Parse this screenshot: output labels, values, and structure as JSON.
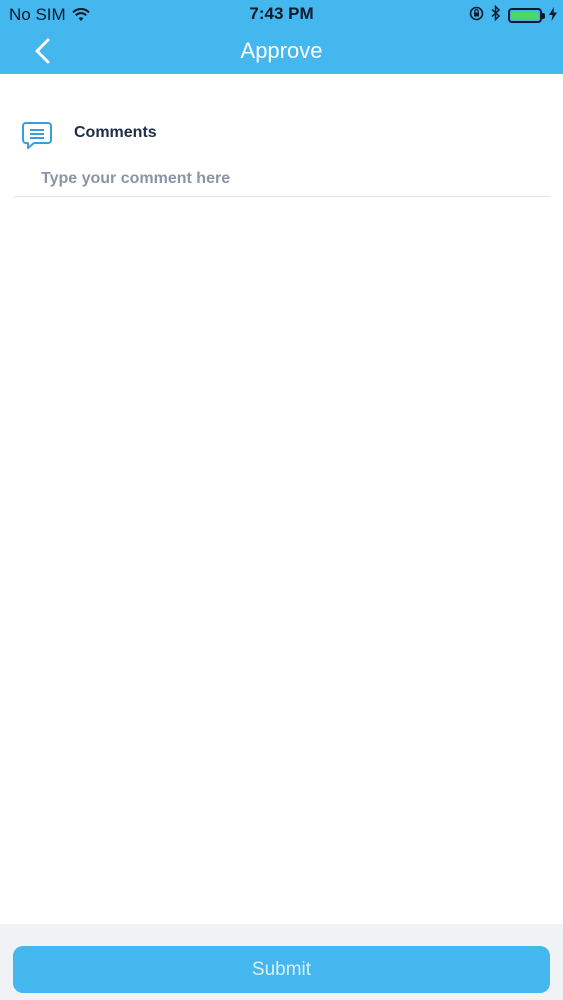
{
  "status_bar": {
    "carrier": "No SIM",
    "time": "7:43 PM"
  },
  "nav": {
    "title": "Approve"
  },
  "comments": {
    "label": "Comments",
    "placeholder": "Type your comment here",
    "value": ""
  },
  "footer": {
    "submit_label": "Submit"
  },
  "colors": {
    "primary": "#43b7ee",
    "label": "#1f2d47",
    "battery": "#4cd964"
  },
  "icons": [
    "wifi-icon",
    "orientation-lock-icon",
    "bluetooth-icon",
    "battery-icon",
    "charging-icon",
    "back-chevron-icon",
    "comment-icon"
  ]
}
